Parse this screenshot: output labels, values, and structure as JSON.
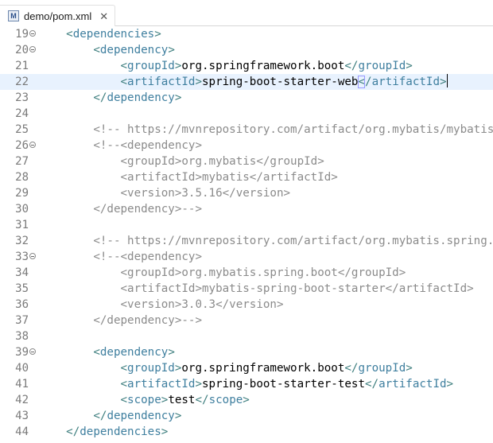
{
  "tab": {
    "icon": "M",
    "title": "demo/pom.xml",
    "close": "✕"
  },
  "lines": [
    {
      "num": "19",
      "fold": true,
      "parts": [
        [
          "x",
          "    "
        ],
        [
          "t",
          "<"
        ],
        [
          "n",
          "dependencies"
        ],
        [
          "t",
          ">"
        ]
      ]
    },
    {
      "num": "20",
      "fold": true,
      "parts": [
        [
          "x",
          "        "
        ],
        [
          "t",
          "<"
        ],
        [
          "n",
          "dependency"
        ],
        [
          "t",
          ">"
        ]
      ]
    },
    {
      "num": "21",
      "fold": false,
      "parts": [
        [
          "x",
          "            "
        ],
        [
          "t",
          "<"
        ],
        [
          "n",
          "groupId"
        ],
        [
          "t",
          ">"
        ],
        [
          "x",
          "org.springframework.boot"
        ],
        [
          "t",
          "</"
        ],
        [
          "n",
          "groupId"
        ],
        [
          "t",
          ">"
        ]
      ]
    },
    {
      "num": "22",
      "fold": false,
      "current": true,
      "parts": [
        [
          "x",
          "            "
        ],
        [
          "t",
          "<"
        ],
        [
          "n",
          "artifactId"
        ],
        [
          "t",
          ">"
        ],
        [
          "x",
          "spring-boot-starter-web"
        ],
        [
          "tb",
          "<"
        ],
        [
          "t",
          "/"
        ],
        [
          "n",
          "artifactId"
        ],
        [
          "t",
          ">"
        ]
      ]
    },
    {
      "num": "23",
      "fold": false,
      "parts": [
        [
          "x",
          "        "
        ],
        [
          "t",
          "</"
        ],
        [
          "n",
          "dependency"
        ],
        [
          "t",
          ">"
        ]
      ]
    },
    {
      "num": "24",
      "fold": false,
      "parts": []
    },
    {
      "num": "25",
      "fold": false,
      "parts": [
        [
          "x",
          "        "
        ],
        [
          "c",
          "<!-- https://mvnrepository.com/artifact/org.mybatis/mybatis -->"
        ]
      ]
    },
    {
      "num": "26",
      "fold": true,
      "parts": [
        [
          "x",
          "        "
        ],
        [
          "c",
          "<!--<dependency>"
        ]
      ]
    },
    {
      "num": "27",
      "fold": false,
      "parts": [
        [
          "c",
          "            <groupId>org.mybatis</groupId>"
        ]
      ]
    },
    {
      "num": "28",
      "fold": false,
      "parts": [
        [
          "c",
          "            <artifactId>mybatis</artifactId>"
        ]
      ]
    },
    {
      "num": "29",
      "fold": false,
      "parts": [
        [
          "c",
          "            <version>3.5.16</version>"
        ]
      ]
    },
    {
      "num": "30",
      "fold": false,
      "parts": [
        [
          "c",
          "        </dependency>-->"
        ]
      ]
    },
    {
      "num": "31",
      "fold": false,
      "parts": []
    },
    {
      "num": "32",
      "fold": false,
      "parts": [
        [
          "x",
          "        "
        ],
        [
          "c",
          "<!-- https://mvnrepository.com/artifact/org.mybatis.spring.boot/mybatis-spring-boot-starter -->"
        ]
      ]
    },
    {
      "num": "33",
      "fold": true,
      "parts": [
        [
          "x",
          "        "
        ],
        [
          "c",
          "<!--<dependency>"
        ]
      ]
    },
    {
      "num": "34",
      "fold": false,
      "parts": [
        [
          "c",
          "            <groupId>org.mybatis.spring.boot</groupId>"
        ]
      ]
    },
    {
      "num": "35",
      "fold": false,
      "parts": [
        [
          "c",
          "            <artifactId>mybatis-spring-boot-starter</artifactId>"
        ]
      ]
    },
    {
      "num": "36",
      "fold": false,
      "parts": [
        [
          "c",
          "            <version>3.0.3</version>"
        ]
      ]
    },
    {
      "num": "37",
      "fold": false,
      "parts": [
        [
          "c",
          "        </dependency>-->"
        ]
      ]
    },
    {
      "num": "38",
      "fold": false,
      "parts": []
    },
    {
      "num": "39",
      "fold": true,
      "parts": [
        [
          "x",
          "        "
        ],
        [
          "t",
          "<"
        ],
        [
          "n",
          "dependency"
        ],
        [
          "t",
          ">"
        ]
      ]
    },
    {
      "num": "40",
      "fold": false,
      "parts": [
        [
          "x",
          "            "
        ],
        [
          "t",
          "<"
        ],
        [
          "n",
          "groupId"
        ],
        [
          "t",
          ">"
        ],
        [
          "x",
          "org.springframework.boot"
        ],
        [
          "t",
          "</"
        ],
        [
          "n",
          "groupId"
        ],
        [
          "t",
          ">"
        ]
      ]
    },
    {
      "num": "41",
      "fold": false,
      "parts": [
        [
          "x",
          "            "
        ],
        [
          "t",
          "<"
        ],
        [
          "n",
          "artifactId"
        ],
        [
          "t",
          ">"
        ],
        [
          "x",
          "spring-boot-starter-test"
        ],
        [
          "t",
          "</"
        ],
        [
          "n",
          "artifactId"
        ],
        [
          "t",
          ">"
        ]
      ]
    },
    {
      "num": "42",
      "fold": false,
      "parts": [
        [
          "x",
          "            "
        ],
        [
          "t",
          "<"
        ],
        [
          "n",
          "scope"
        ],
        [
          "t",
          ">"
        ],
        [
          "x",
          "test"
        ],
        [
          "t",
          "</"
        ],
        [
          "n",
          "scope"
        ],
        [
          "t",
          ">"
        ]
      ]
    },
    {
      "num": "43",
      "fold": false,
      "parts": [
        [
          "x",
          "        "
        ],
        [
          "t",
          "</"
        ],
        [
          "n",
          "dependency"
        ],
        [
          "t",
          ">"
        ]
      ]
    },
    {
      "num": "44",
      "fold": false,
      "parts": [
        [
          "x",
          "    "
        ],
        [
          "t",
          "</"
        ],
        [
          "n",
          "dependencies"
        ],
        [
          "t",
          ">"
        ]
      ]
    }
  ]
}
